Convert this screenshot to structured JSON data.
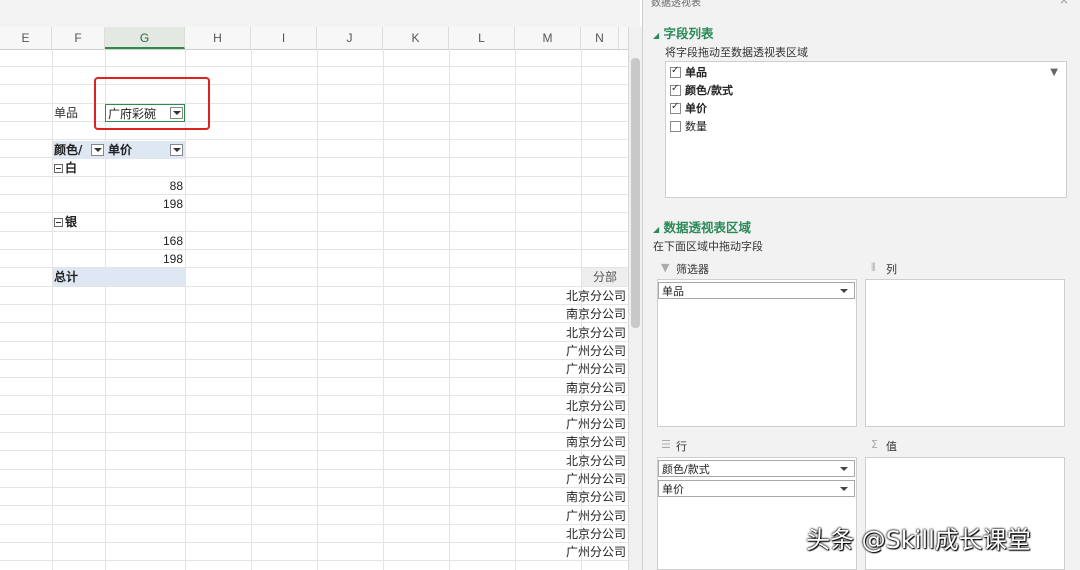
{
  "columns": [
    {
      "label": "E",
      "selected": false
    },
    {
      "label": "F",
      "selected": false
    },
    {
      "label": "G",
      "selected": true
    },
    {
      "label": "H",
      "selected": false
    },
    {
      "label": "I",
      "selected": false
    },
    {
      "label": "J",
      "selected": false
    },
    {
      "label": "K",
      "selected": false
    },
    {
      "label": "L",
      "selected": false
    },
    {
      "label": "M",
      "selected": false
    },
    {
      "label": "N",
      "selected": false
    }
  ],
  "pivot": {
    "filter_label": "单品",
    "filter_value": "广府彩碗",
    "row_header": "颜色/",
    "value_header": "单价",
    "groups": [
      {
        "name": "白",
        "values": [
          "88",
          "198"
        ]
      },
      {
        "name": "银",
        "values": [
          "168",
          "198"
        ]
      }
    ],
    "total_label": "总计"
  },
  "side_list": {
    "header": "分部",
    "items": [
      "北京分公司",
      "南京分公司",
      "北京分公司",
      "广州分公司",
      "广州分公司",
      "南京分公司",
      "北京分公司",
      "广州分公司",
      "南京分公司",
      "北京分公司",
      "广州分公司",
      "南京分公司",
      "广州分公司",
      "北京分公司",
      "广州分公司"
    ]
  },
  "panel": {
    "title": "数据透视表",
    "field_list_title": "字段列表",
    "field_list_hint": "将字段拖动至数据透视表区域",
    "fields": [
      {
        "label": "单品",
        "checked": true,
        "bold": true
      },
      {
        "label": "颜色/款式",
        "checked": true,
        "bold": true
      },
      {
        "label": "单价",
        "checked": true,
        "bold": true
      },
      {
        "label": "数量",
        "checked": false,
        "bold": false
      }
    ],
    "areas_title": "数据透视表区域",
    "areas_hint": "在下面区域中拖动字段",
    "filter_area_label": "筛选器",
    "column_area_label": "列",
    "row_area_label": "行",
    "value_area_label": "值",
    "filter_items": [
      "单品"
    ],
    "row_items": [
      "颜色/款式",
      "单价"
    ]
  },
  "watermark": "头条 @Skill成长课堂",
  "accent_color": "#2b8a57",
  "highlight_color": "#e0221e"
}
